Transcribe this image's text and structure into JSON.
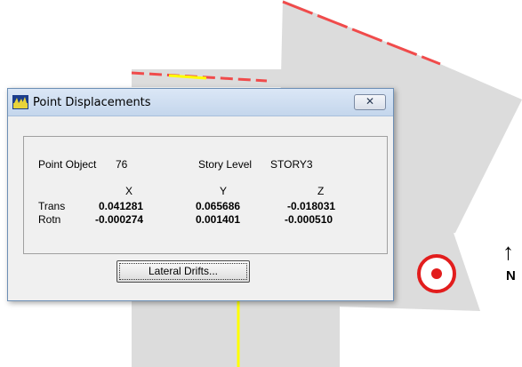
{
  "dialog": {
    "title": "Point Displacements",
    "close_glyph": "✕",
    "point_object_label": "Point Object",
    "point_object_value": "76",
    "story_level_label": "Story Level",
    "story_level_value": "STORY3",
    "headers": [
      "X",
      "Y",
      "Z"
    ],
    "rows": [
      {
        "label": "Trans",
        "values": [
          "0.041281",
          "0.065686",
          "-0.018031"
        ]
      },
      {
        "label": "Rotn",
        "values": [
          "-0.000274",
          "0.001401",
          "-0.000510"
        ]
      }
    ],
    "lateral_drifts_label": "Lateral Drifts..."
  },
  "viewport": {
    "north_label": "N",
    "north_arrow": "↑",
    "colors": {
      "plane": "#dcdcdc",
      "red_edge": "#f04b4b",
      "yellow_edge": "#ffff00",
      "marker": "#e21d1d"
    }
  }
}
